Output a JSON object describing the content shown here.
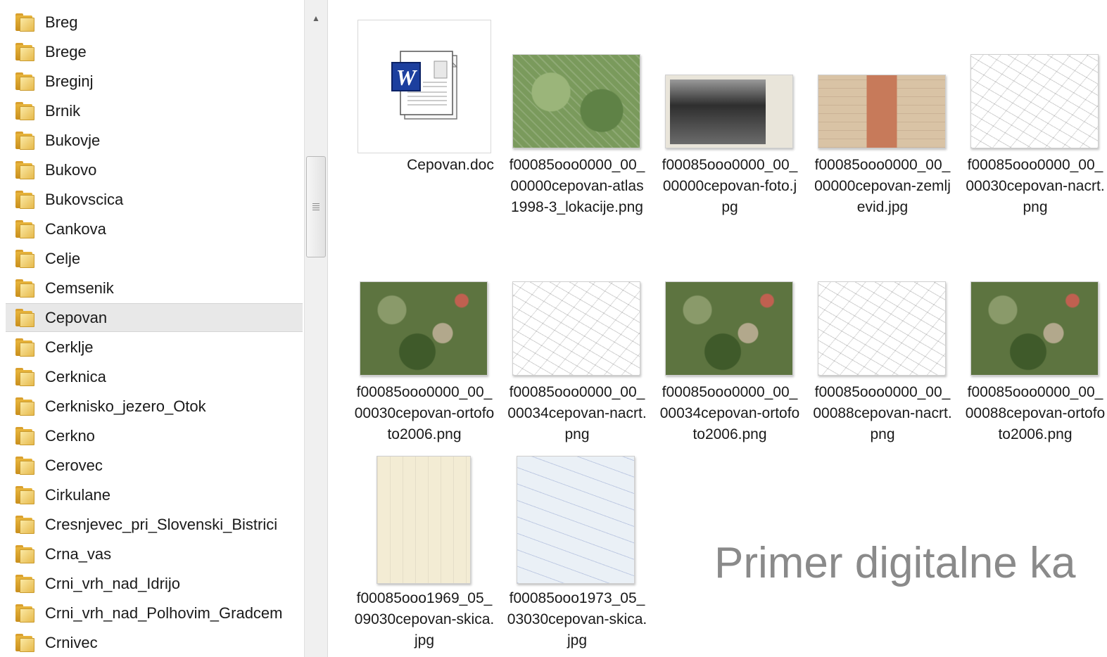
{
  "folder_tree": {
    "items": [
      {
        "label": "Breg"
      },
      {
        "label": "Brege"
      },
      {
        "label": "Breginj"
      },
      {
        "label": "Brnik"
      },
      {
        "label": "Bukovje"
      },
      {
        "label": "Bukovo"
      },
      {
        "label": "Bukovscica"
      },
      {
        "label": "Cankova"
      },
      {
        "label": "Celje"
      },
      {
        "label": "Cemsenik"
      },
      {
        "label": "Cepovan"
      },
      {
        "label": "Cerklje"
      },
      {
        "label": "Cerknica"
      },
      {
        "label": "Cerknisko_jezero_Otok"
      },
      {
        "label": "Cerkno"
      },
      {
        "label": "Cerovec"
      },
      {
        "label": "Cirkulane"
      },
      {
        "label": "Cresnjevec_pri_Slovenski_Bistrici"
      },
      {
        "label": "Crna_vas"
      },
      {
        "label": "Crni_vrh_nad_Idrijo"
      },
      {
        "label": "Crni_vrh_nad_Polhovim_Gradcem"
      },
      {
        "label": "Crnivec"
      }
    ],
    "selected": "Cepovan"
  },
  "files": [
    {
      "name": "Cepovan.doc",
      "kind": "word-document-icon"
    },
    {
      "name": "f00085ooo0000_00_00000cepovan-atlas1998-3_lokacije.png",
      "kind": "map"
    },
    {
      "name": "f00085ooo0000_00_00000cepovan-foto.jpg",
      "kind": "photo"
    },
    {
      "name": "f00085ooo0000_00_00000cepovan-zemljevid.jpg",
      "kind": "zemljevid"
    },
    {
      "name": "f00085ooo0000_00_00030cepovan-nacrt.png",
      "kind": "nacrt"
    },
    {
      "name": "f00085ooo0000_00_00030cepovan-ortofoto2006.png",
      "kind": "ortofoto"
    },
    {
      "name": "f00085ooo0000_00_00034cepovan-nacrt.png",
      "kind": "nacrt"
    },
    {
      "name": "f00085ooo0000_00_00034cepovan-ortofoto2006.png",
      "kind": "ortofoto"
    },
    {
      "name": "f00085ooo0000_00_00088cepovan-nacrt.png",
      "kind": "nacrt"
    },
    {
      "name": "f00085ooo0000_00_00088cepovan-ortofoto2006.png",
      "kind": "ortofoto"
    },
    {
      "name": "f00085ooo1969_05_09030cepovan-skica.jpg",
      "kind": "skica"
    },
    {
      "name": "f00085ooo1973_05_03030cepovan-skica.jpg",
      "kind": "skica"
    }
  ],
  "overlay_caption": "Primer digitalne ka",
  "colors": {
    "folder": "#e8b53c",
    "selected_row": "#e8e8e8",
    "caption": "#8a8a8a"
  }
}
